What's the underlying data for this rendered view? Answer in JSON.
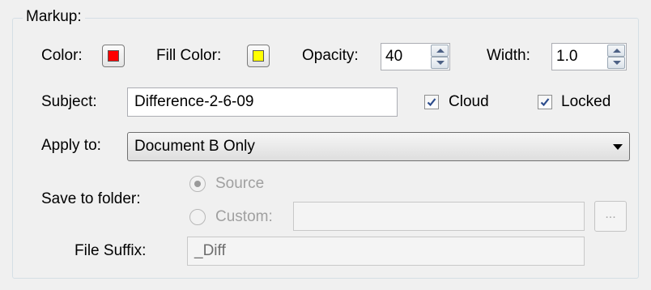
{
  "markup": {
    "group_title": "Markup:",
    "color_label": "Color:",
    "color_value": "#ff0000",
    "fill_color_label": "Fill Color:",
    "fill_color_value": "#ffff00",
    "opacity_label": "Opacity:",
    "opacity_value": "40",
    "width_label": "Width:",
    "width_value": "1.0",
    "subject_label": "Subject:",
    "subject_value": "Difference-2-6-09",
    "cloud_label": "Cloud",
    "cloud_checked": true,
    "locked_label": "Locked",
    "locked_checked": true,
    "apply_to_label": "Apply to:",
    "apply_to_value": "Document B Only",
    "save_to_folder_label": "Save to folder:",
    "source_label": "Source",
    "source_selected": true,
    "custom_label": "Custom:",
    "custom_value": "",
    "browse_label": "...",
    "file_suffix_label": "File Suffix:",
    "file_suffix_value": "_Diff"
  },
  "icons": {
    "spin_up": "arrow-up-icon",
    "spin_down": "arrow-down-icon",
    "combo_drop": "chevron-down-icon",
    "checkmark": "checkmark-icon"
  },
  "colors": {
    "panel_bg": "#f0f0f0",
    "disabled_text": "#a0a0a0",
    "checkmark": "#2c4c8c"
  }
}
